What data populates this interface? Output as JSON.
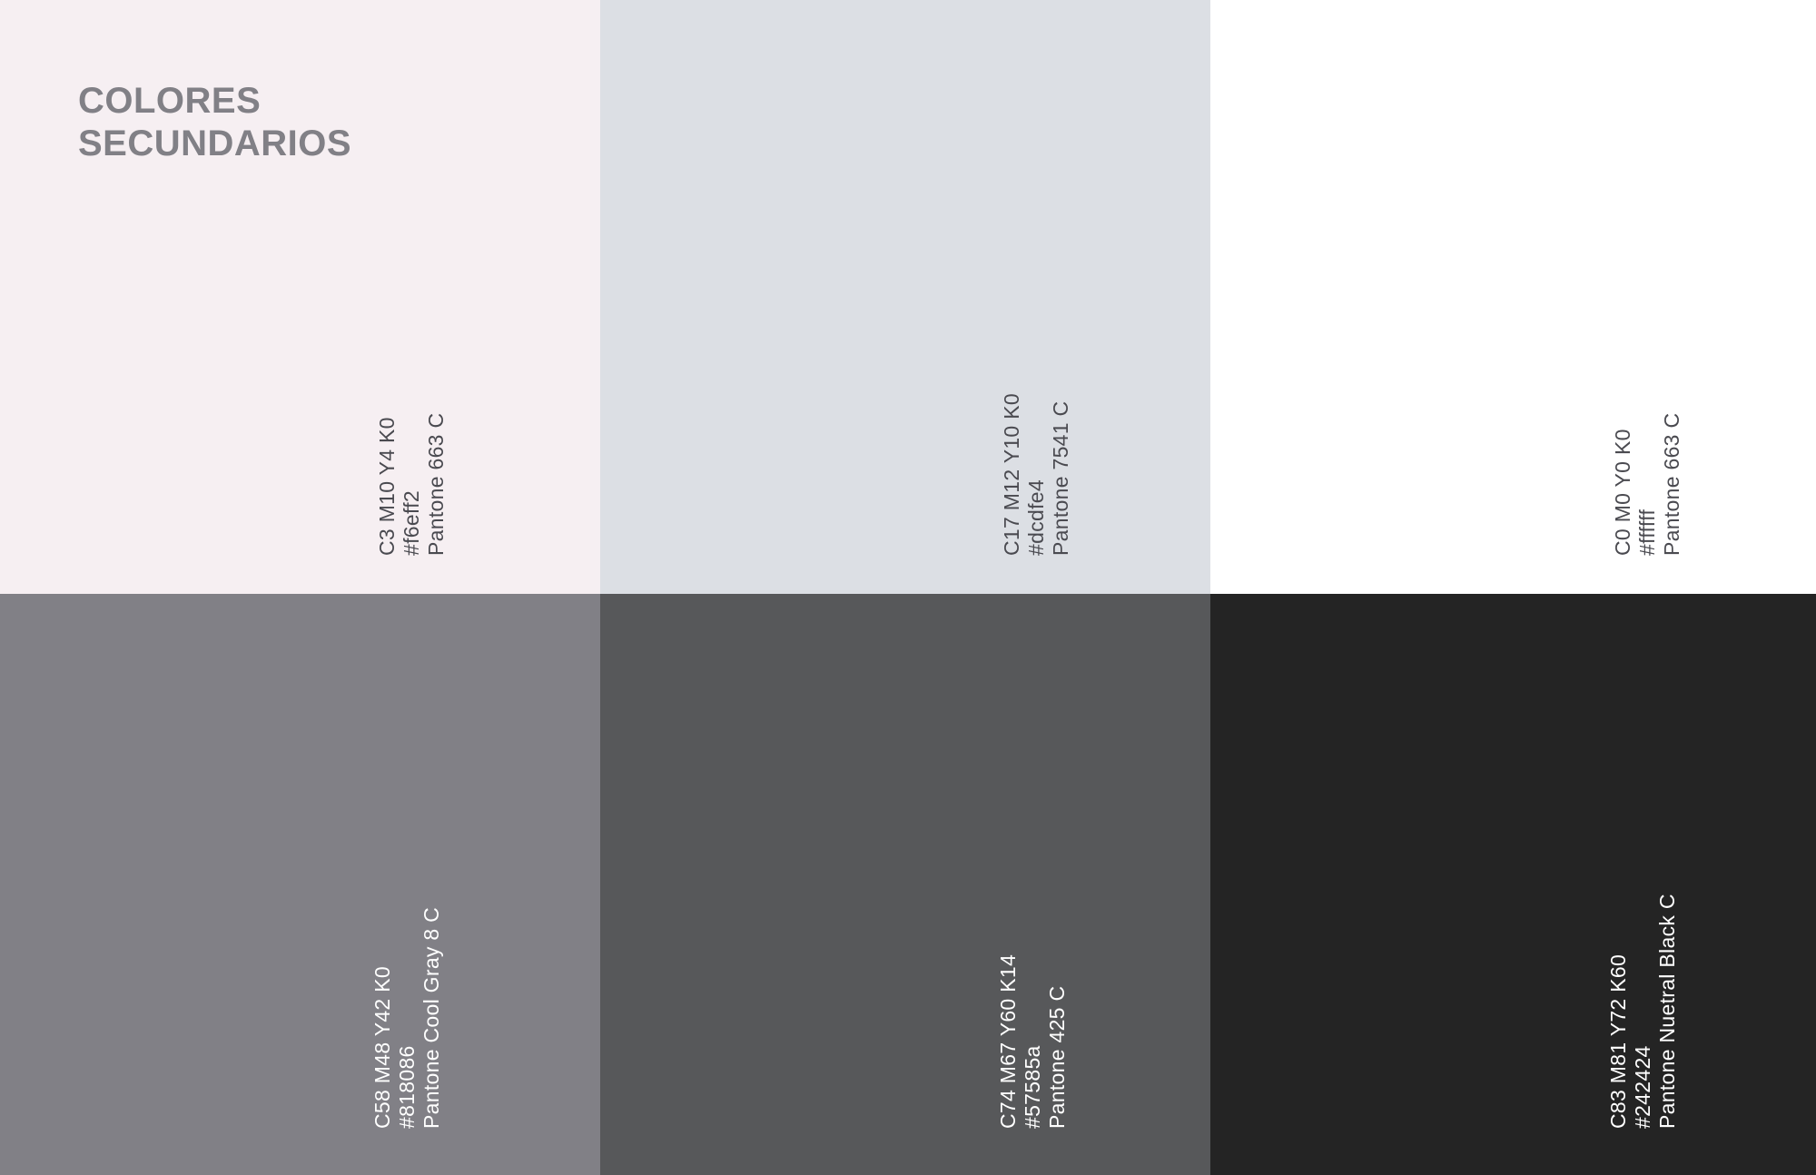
{
  "heading": {
    "line1": "COLORES",
    "line2": "SECUNDARIOS"
  },
  "swatches": [
    {
      "name": "pale-pink",
      "color": "#f6eff2",
      "text_color": "#4a4a50",
      "cmyk": "C3 M10 Y4 K0",
      "hex": "#f6eff2",
      "pantone": "Pantone 663 C"
    },
    {
      "name": "pale-blue-gray",
      "color": "#dcdfe4",
      "text_color": "#4a4a50",
      "cmyk": "C17 M12 Y10 K0",
      "hex": "#dcdfe4",
      "pantone": "Pantone 7541 C"
    },
    {
      "name": "white",
      "color": "#ffffff",
      "text_color": "#4a4a50",
      "cmyk": "C0 M0 Y0 K0",
      "hex": "#ffffff",
      "pantone": "Pantone 663 C"
    },
    {
      "name": "cool-gray",
      "color": "#818086",
      "text_color": "#ffffff",
      "cmyk": "C58 M48 Y42 K0",
      "hex": "#818086",
      "pantone": "Pantone Cool Gray 8 C"
    },
    {
      "name": "dark-gray",
      "color": "#57585a",
      "text_color": "#ffffff",
      "cmyk": "C74 M67 Y60 K14",
      "hex": "#57585a",
      "pantone": "Pantone 425 C"
    },
    {
      "name": "near-black",
      "color": "#242424",
      "text_color": "#ffffff",
      "cmyk": "C83 M81 Y72 K60",
      "hex": "#242424",
      "pantone": "Pantone Nuetral Black C"
    }
  ]
}
